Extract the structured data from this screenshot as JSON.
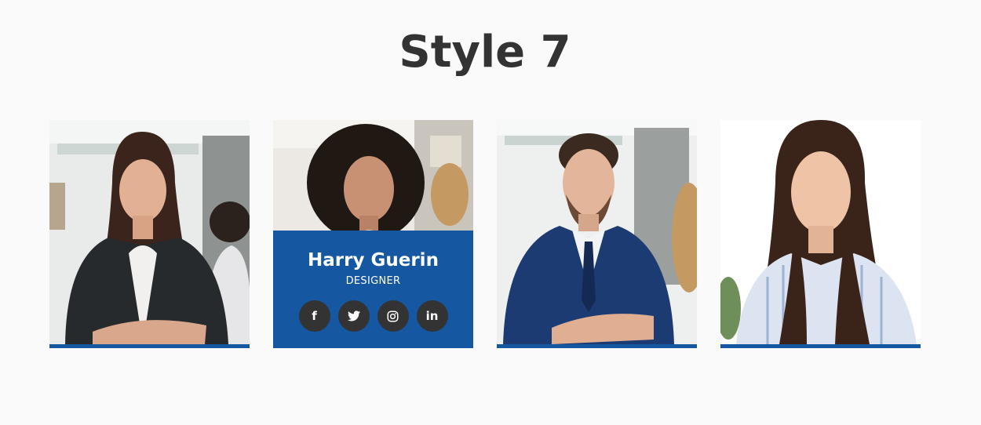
{
  "page": {
    "title": "Style 7"
  },
  "colors": {
    "background": "#fafafa",
    "accent": "#1557a0",
    "title": "#333333",
    "social_bg": "#333333"
  },
  "members": [
    {
      "photo": "woman-dark-blazer-arms-crossed",
      "show_overlay": false
    },
    {
      "photo": "woman-curly-hair-smiling",
      "show_overlay": true,
      "name": "Harry Guerin",
      "role": "DESIGNER",
      "socials": [
        {
          "icon": "facebook-icon",
          "glyph": "f"
        },
        {
          "icon": "twitter-icon",
          "glyph": "🐦"
        },
        {
          "icon": "instagram-icon",
          "glyph": "◎"
        },
        {
          "icon": "linkedin-icon",
          "glyph": "in"
        }
      ]
    },
    {
      "photo": "man-navy-suit-arms-crossed",
      "show_overlay": false
    },
    {
      "photo": "woman-striped-shirt-smiling",
      "show_overlay": false
    }
  ]
}
